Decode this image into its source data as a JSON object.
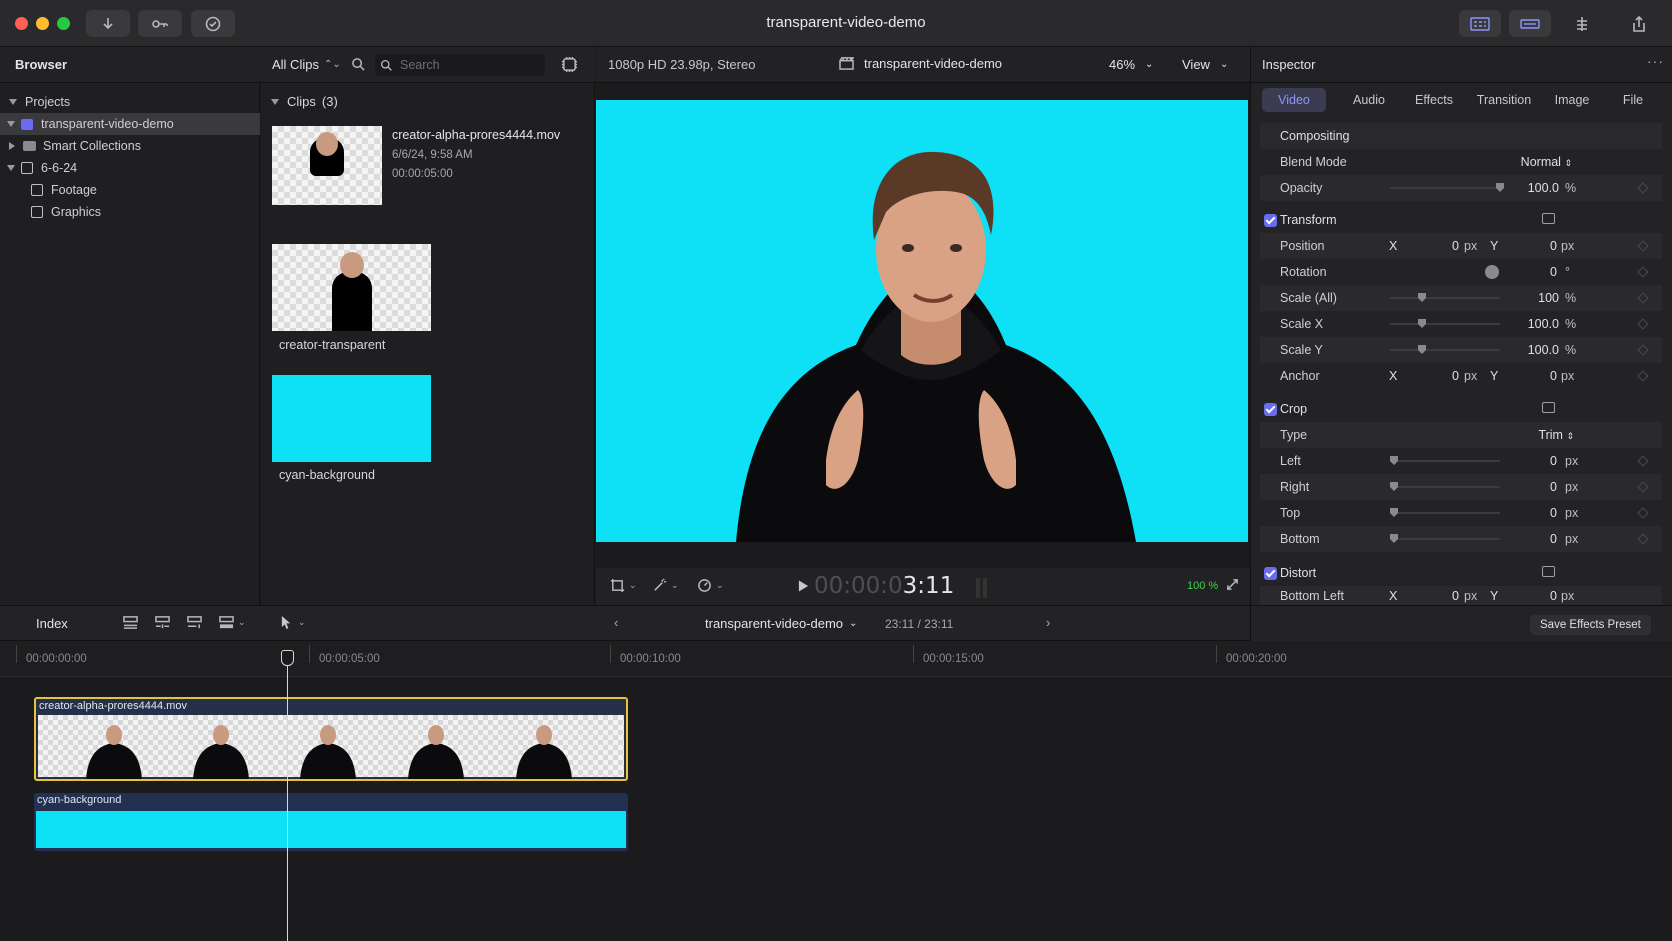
{
  "window": {
    "title": "transparent-video-demo"
  },
  "browser": {
    "title": "Browser",
    "filter": "All Clips",
    "search_placeholder": "Search",
    "tree": {
      "projects": "Projects",
      "project": "transparent-video-demo",
      "smart_collections": "Smart Collections",
      "event": "6-6-24",
      "footage": "Footage",
      "graphics": "Graphics"
    },
    "clips_header": "Clips",
    "clips_count": "(3)",
    "clips": [
      {
        "name": "creator-alpha-prores4444.mov",
        "date": "6/6/24, 9:58 AM",
        "duration": "00:00:05:00"
      },
      {
        "name": "creator-transparent"
      },
      {
        "name": "cyan-background"
      }
    ]
  },
  "viewer": {
    "format": "1080p HD 23.98p, Stereo",
    "project": "transparent-video-demo",
    "zoom": "46%",
    "view_label": "View",
    "timecode_dim": "00:00:0",
    "timecode_bright": "3:11",
    "zoom_fit": "100 %",
    "background_color": "#0ee0f5"
  },
  "inspector": {
    "title": "Inspector",
    "tabs": [
      "Video",
      "Audio",
      "Effects",
      "Transition",
      "Image",
      "File"
    ],
    "active_tab": "Video",
    "compositing": {
      "label": "Compositing",
      "blend_mode_label": "Blend Mode",
      "blend_mode_value": "Normal",
      "opacity_label": "Opacity",
      "opacity_value": "100.0",
      "opacity_unit": "%"
    },
    "transform": {
      "label": "Transform",
      "position_label": "Position",
      "x_label": "X",
      "y_label": "Y",
      "position_x": "0",
      "position_y": "0",
      "unit_px": "px",
      "rotation_label": "Rotation",
      "rotation_value": "0",
      "rotation_unit": "°",
      "scale_all_label": "Scale (All)",
      "scale_all_value": "100",
      "scale_x_label": "Scale X",
      "scale_x_value": "100.0",
      "scale_y_label": "Scale Y",
      "scale_y_value": "100.0",
      "percent": "%",
      "anchor_label": "Anchor",
      "anchor_x": "0",
      "anchor_y": "0"
    },
    "crop": {
      "label": "Crop",
      "type_label": "Type",
      "type_value": "Trim",
      "left_label": "Left",
      "right_label": "Right",
      "top_label": "Top",
      "bottom_label": "Bottom",
      "value": "0",
      "unit": "px"
    },
    "distort": {
      "label": "Distort",
      "bottom_left_label": "Bottom Left",
      "x": "0",
      "y": "0"
    },
    "save_preset": "Save Effects Preset"
  },
  "timeline": {
    "index_label": "Index",
    "project": "transparent-video-demo",
    "duration": "23:11 / 23:11",
    "ruler": [
      "00:00:00:00",
      "00:00:05:00",
      "00:00:10:00",
      "00:00:15:00",
      "00:00:20:00"
    ],
    "clip_fg": "creator-alpha-prores4444.mov",
    "clip_bg": "cyan-background"
  }
}
